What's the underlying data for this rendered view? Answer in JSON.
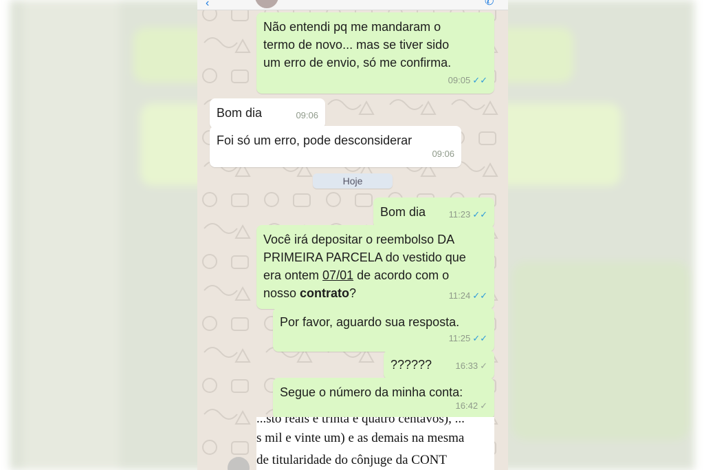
{
  "messages": [
    {
      "lines": [
        "Não entendi pq me mandaram o",
        "termo de novo... mas se tiver sido",
        "um erro de envio, só me confirma."
      ],
      "time": "09:05",
      "ticks": "✓✓"
    },
    {
      "text": "Bom dia",
      "time": "09:06"
    },
    {
      "text": "Foi só um erro, pode desconsiderar",
      "time": "09:06"
    },
    {
      "text": "Bom dia",
      "time": "11:23",
      "ticks": "✓✓"
    },
    {
      "line1": "Você irá depositar o reembolso DA",
      "line2": "PRIMEIRA PARCELA do vestido que",
      "line3_a": "era ontem ",
      "line3_date": "07/01",
      "line3_b": " de acordo com o",
      "line4_a": "nosso ",
      "line4_bold": "contrato",
      "line4_b": "?",
      "time": "11:24",
      "ticks": "✓✓"
    },
    {
      "text": "Por favor, aguardo sua resposta.",
      "time": "11:25",
      "ticks": "✓✓"
    },
    {
      "text": "??????",
      "time": "16:33",
      "ticks": "✓"
    },
    {
      "text": "Segue o número da minha conta:",
      "time": "16:42",
      "ticks": "✓"
    }
  ],
  "date_divider": "Hoje",
  "document_lines": [
    "...sto reais e trinta e quatro centavos), ...",
    "s mil e vinte um) e as demais na mesma",
    "de titularidade do cônjuge da CONT"
  ],
  "colors": {
    "outgoing": "#dcf8c6",
    "incoming": "#ffffff",
    "read_ticks": "#2f9bd9"
  }
}
